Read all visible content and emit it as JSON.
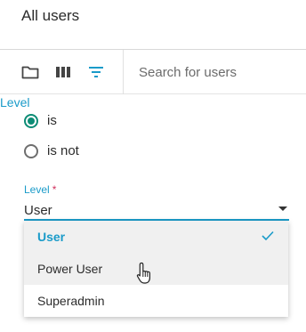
{
  "header": {
    "title": "All users"
  },
  "toolbar": {
    "icons": [
      "folder-icon",
      "columns-icon",
      "filter-icon"
    ],
    "search_placeholder": "Search for users"
  },
  "filter": {
    "heading": "Level",
    "options": [
      {
        "label": "is",
        "checked": true
      },
      {
        "label": "is not",
        "checked": false
      }
    ]
  },
  "level_select": {
    "label": "Level",
    "required_marker": "*",
    "value": "User",
    "options": [
      {
        "label": "User",
        "selected": true
      },
      {
        "label": "Power User",
        "selected": false
      },
      {
        "label": "Superadmin",
        "selected": false
      }
    ]
  },
  "colors": {
    "accent": "#1a9bc9",
    "radio_checked": "#0c8c75",
    "required": "#d0305d"
  }
}
